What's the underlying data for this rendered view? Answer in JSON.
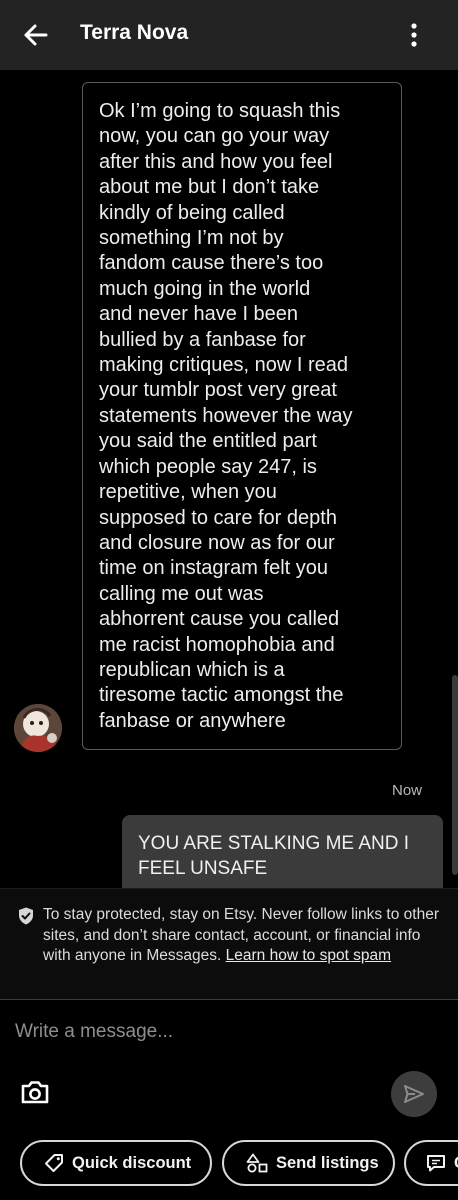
{
  "header": {
    "title": "Terra Nova",
    "back_icon": "arrow-left-icon",
    "menu_icon": "kebab-menu-icon"
  },
  "messages": {
    "incoming": {
      "text": "Ok I’m going to squash this\nnow, you can go your way\nafter this and how you feel\nabout me but I don’t take\nkindly of being called\nsomething I’m not by\nfandom cause there’s too\nmuch going in the world\nand never have I been\nbullied by a fanbase for\nmaking critiques, now I read\nyour tumblr  post very great\nstatements however the way\nyou said the entitled part\nwhich people say 247, is\nrepetitive, when you\nsupposed to care for depth\nand closure now as for our\ntime on instagram felt you\ncalling me out was\nabhorrent cause you called\nme racist homophobia and\nrepublican which is a\ntiresome tactic amongst the\nfanbase or anywhere"
    },
    "timestamp": "Now",
    "outgoing": {
      "text": "YOU ARE STALKING ME AND I FEEL UNSAFE"
    }
  },
  "notice": {
    "icon": "shield-check-icon",
    "text": "To stay protected, stay on Etsy. Never follow links to other sites, and don’t share contact, account, or financial info with anyone in Messages. ",
    "link": "Learn how to spot spam"
  },
  "composer": {
    "placeholder": "Write a message...",
    "camera_icon": "camera-icon",
    "send_icon": "send-icon"
  },
  "chips": {
    "quick_discount": "Quick discount",
    "send_listings": "Send listings",
    "third_label": "C"
  },
  "colors": {
    "header_bg": "#232323",
    "outgoing_bubble": "#3b3b3b",
    "background": "#000000"
  }
}
